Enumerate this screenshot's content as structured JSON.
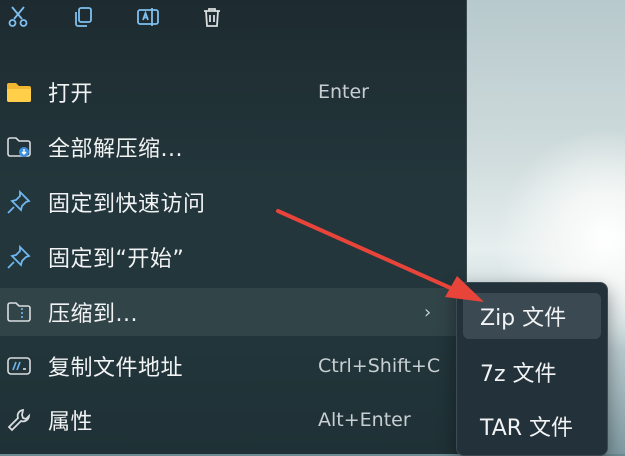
{
  "toolbar": {
    "icons": [
      "cut-icon",
      "copy-icon",
      "rename-icon",
      "delete-icon"
    ]
  },
  "menu": {
    "items": [
      {
        "label": "打开",
        "shortcut": "Enter",
        "icon": "folder-icon"
      },
      {
        "label": "全部解压缩...",
        "shortcut": "",
        "icon": "extract-all-icon"
      },
      {
        "label": "固定到快速访问",
        "shortcut": "",
        "icon": "pin-icon"
      },
      {
        "label": "固定到“开始”",
        "shortcut": "",
        "icon": "pin-icon"
      },
      {
        "label": "压缩到...",
        "shortcut": "",
        "icon": "compress-icon",
        "chevron": "›"
      },
      {
        "label": "复制文件地址",
        "shortcut": "Ctrl+Shift+C",
        "icon": "copy-path-icon"
      },
      {
        "label": "属性",
        "shortcut": "Alt+Enter",
        "icon": "wrench-icon"
      }
    ]
  },
  "submenu": {
    "items": [
      {
        "label": "Zip 文件"
      },
      {
        "label": "7z 文件"
      },
      {
        "label": "TAR 文件"
      }
    ]
  },
  "colors": {
    "menu_bg": "#22353a",
    "highlight": "#3b4a52",
    "arrow": "#e8443a",
    "accent_icon": "#6fb7f0"
  }
}
